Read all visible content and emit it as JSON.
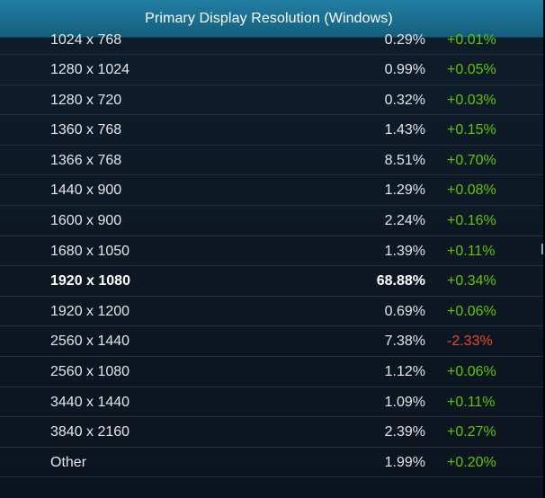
{
  "header": {
    "title": "Primary Display Resolution (Windows)"
  },
  "rows": [
    {
      "resolution": "1024 x 768",
      "percent": "0.29%",
      "change": "+0.01%",
      "direction": "up"
    },
    {
      "resolution": "1280 x 1024",
      "percent": "0.99%",
      "change": "+0.05%",
      "direction": "up"
    },
    {
      "resolution": "1280 x 720",
      "percent": "0.32%",
      "change": "+0.03%",
      "direction": "up"
    },
    {
      "resolution": "1360 x 768",
      "percent": "1.43%",
      "change": "+0.15%",
      "direction": "up"
    },
    {
      "resolution": "1366 x 768",
      "percent": "8.51%",
      "change": "+0.70%",
      "direction": "up"
    },
    {
      "resolution": "1440 x 900",
      "percent": "1.29%",
      "change": "+0.08%",
      "direction": "up"
    },
    {
      "resolution": "1600 x 900",
      "percent": "2.24%",
      "change": "+0.16%",
      "direction": "up"
    },
    {
      "resolution": "1680 x 1050",
      "percent": "1.39%",
      "change": "+0.11%",
      "direction": "up"
    },
    {
      "resolution": "1920 x 1080",
      "percent": "68.88%",
      "change": "+0.34%",
      "direction": "up",
      "highlight": true
    },
    {
      "resolution": "1920 x 1200",
      "percent": "0.69%",
      "change": "+0.06%",
      "direction": "up"
    },
    {
      "resolution": "2560 x 1440",
      "percent": "7.38%",
      "change": "-2.33%",
      "direction": "down"
    },
    {
      "resolution": "2560 x 1080",
      "percent": "1.12%",
      "change": "+0.06%",
      "direction": "up"
    },
    {
      "resolution": "3440 x 1440",
      "percent": "1.09%",
      "change": "+0.11%",
      "direction": "up"
    },
    {
      "resolution": "3840 x 2160",
      "percent": "2.39%",
      "change": "+0.27%",
      "direction": "up"
    },
    {
      "resolution": "Other",
      "percent": "1.99%",
      "change": "+0.20%",
      "direction": "up"
    }
  ],
  "colors": {
    "header": "#1a6d8f",
    "positive": "#61c500",
    "negative": "#e8452c",
    "text": "#e4e6e8"
  }
}
